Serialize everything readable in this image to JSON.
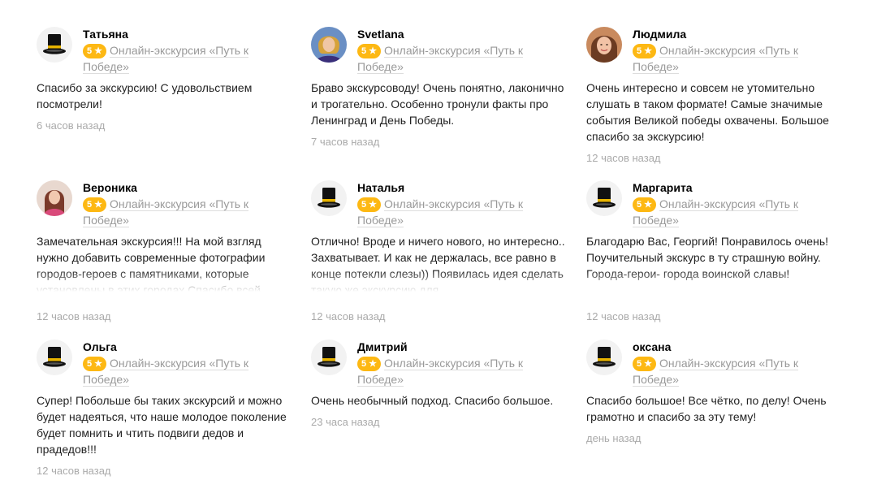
{
  "reviews": [
    {
      "author": "Татьяна",
      "rating": "5 ★",
      "tour": "Онлайн-экскурсия «Путь к Победе»",
      "avatar": "top-hat-icon",
      "text": "Спасибо за экскурсию! С удовольствием посмотрели!",
      "time": "6 часов назад"
    },
    {
      "author": "Svetlana",
      "rating": "5 ★",
      "tour": "Онлайн-экскурсия «Путь к Победе»",
      "avatar": "user-photo",
      "text": "Браво экскурсоводу! Очень понятно, лаконично и трогательно. Особенно тронули факты про Ленинград и День Победы.",
      "time": "7 часов назад"
    },
    {
      "author": "Людмила",
      "rating": "5 ★",
      "tour": "Онлайн-экскурсия «Путь к Победе»",
      "avatar": "user-photo",
      "text": "Очень интересно и совсем не утомительно слушать в таком формате! Самые значимые события Великой победы охвачены. Большое спасибо за экскурсию!",
      "time": "12 часов назад"
    },
    {
      "author": "Вероника",
      "rating": "5 ★",
      "tour": "Онлайн-экскурсия «Путь к Победе»",
      "avatar": "user-photo",
      "text": "Замечательная экскурсия!!! На мой взгляд нужно добавить современные фотографии городов-героев с памятниками, которые установлены в этих городах.Спасибо всей команде за",
      "time": "12 часов назад"
    },
    {
      "author": "Наталья",
      "rating": "5 ★",
      "tour": "Онлайн-экскурсия «Путь к Победе»",
      "avatar": "top-hat-icon",
      "text": "Отлично! Вроде и ничего нового, но интересно.. Захватывает. И как не держалась, все равно в конце потекли слезы)) Появилась идея сделать такую же экскурсию для",
      "time": "12 часов назад"
    },
    {
      "author": "Маргарита",
      "rating": "5 ★",
      "tour": "Онлайн-экскурсия «Путь к Победе»",
      "avatar": "top-hat-icon",
      "text": "Благодарю Вас, Георгий! Понравилось очень! Поучительный экскурс в ту страшную войну. Города-герои- города воинской славы!",
      "time": "12 часов назад"
    },
    {
      "author": "Ольга",
      "rating": "5 ★",
      "tour": "Онлайн-экскурсия «Путь к Победе»",
      "avatar": "top-hat-icon",
      "text": "Супер! Побольше бы таких экскурсий и можно будет надеяться, что наше молодое поколение будет помнить и чтить подвиги дедов и прадедов!!!",
      "time": "12 часов назад"
    },
    {
      "author": "Дмитрий",
      "rating": "5 ★",
      "tour": "Онлайн-экскурсия «Путь к Победе»",
      "avatar": "top-hat-icon",
      "text": "Очень необычный подход. Спасибо большое.",
      "time": "23 часа назад"
    },
    {
      "author": "оксана",
      "rating": "5 ★",
      "tour": "Онлайн-экскурсия «Путь к Победе»",
      "avatar": "top-hat-icon",
      "text": "Спасибо большое! Все чётко, по делу! Очень грамотно и спасибо за эту тему!",
      "time": "день назад"
    }
  ],
  "colors": {
    "badge": "#fdb813",
    "muted": "#999999",
    "time": "#aaaaaa"
  }
}
